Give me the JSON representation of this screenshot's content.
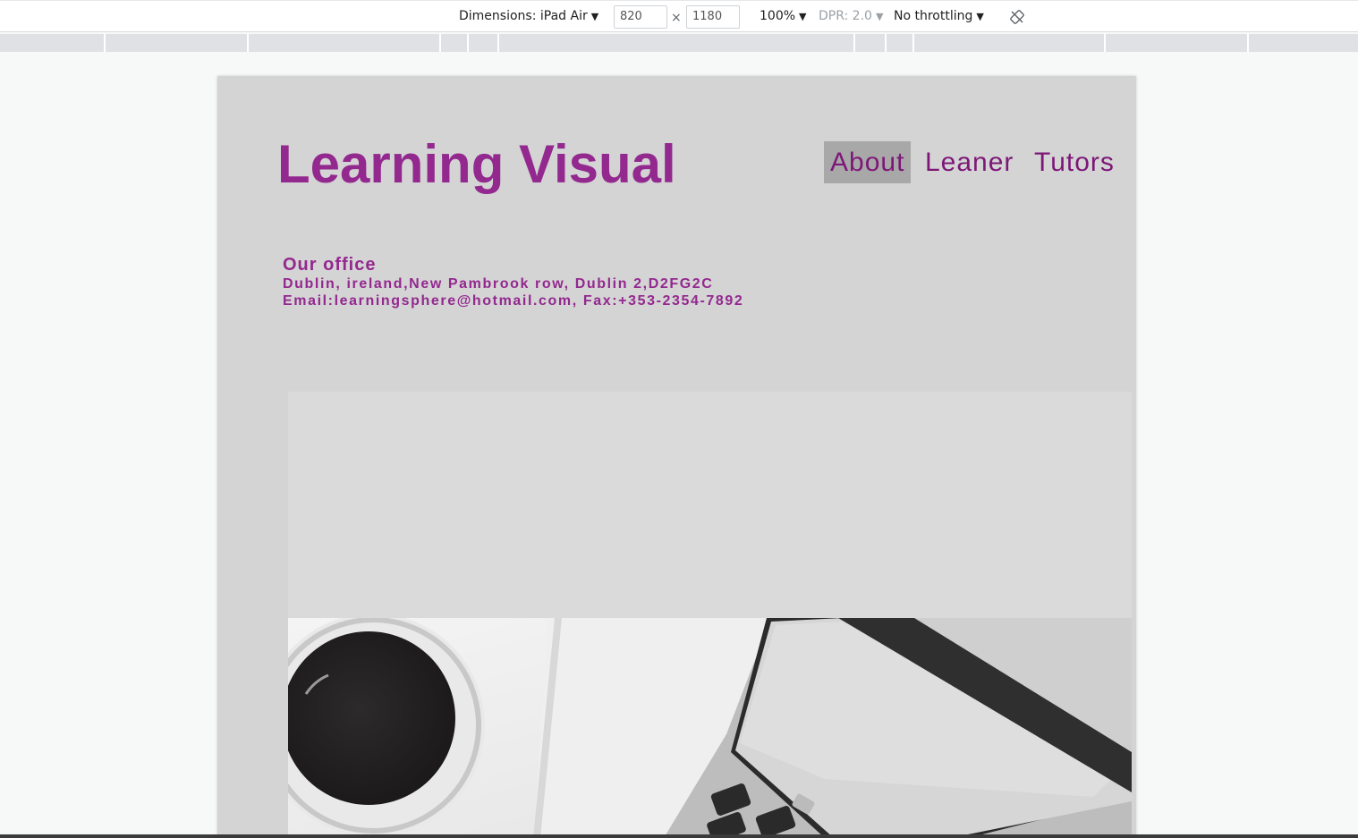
{
  "devtools": {
    "dimensions_label": "Dimensions: iPad Air",
    "width_value": "820",
    "times_symbol": "×",
    "height_value": "1180",
    "zoom": "100%",
    "dpr": "DPR: 2.0",
    "throttling": "No throttling"
  },
  "site": {
    "title": "Learning Visual",
    "nav": [
      {
        "label": "About",
        "active": true
      },
      {
        "label": "Leaner",
        "active": false
      },
      {
        "label": "Tutors",
        "active": false
      }
    ],
    "office": {
      "heading": "Our office",
      "address": "Dublin, ireland,New Pambrook row, Dublin 2,D2FG2C",
      "contact": "Email:learningsphere@hotmail.com, Fax:+353-2354-7892"
    }
  },
  "colors": {
    "brand_purple": "#93288f",
    "nav_purple": "#7d1778",
    "page_bg": "#d4d4d4",
    "nav_active_bg": "#a8a8a8"
  }
}
